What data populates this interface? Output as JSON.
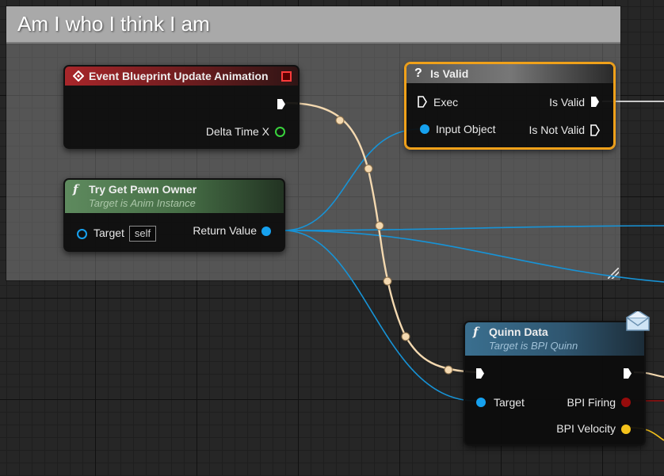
{
  "comment": {
    "title": "Am I who I think I am"
  },
  "nodes": {
    "event_update": {
      "title": "Event Blueprint Update Animation",
      "delta_time_label": "Delta Time X"
    },
    "try_get_pawn_owner": {
      "title": "Try Get Pawn Owner",
      "subtitle": "Target is Anim Instance",
      "target_label": "Target",
      "target_value": "self",
      "return_label": "Return Value"
    },
    "is_valid": {
      "title": "Is Valid",
      "exec_label": "Exec",
      "input_object_label": "Input Object",
      "is_valid_label": "Is Valid",
      "is_not_valid_label": "Is Not Valid"
    },
    "quinn_data": {
      "title": "Quinn Data",
      "subtitle": "Target is BPI Quinn",
      "target_label": "Target",
      "bpi_firing_label": "BPI Firing",
      "bpi_velocity_label": "BPI Velocity"
    }
  },
  "icons": {
    "event": "diamond-event-icon",
    "function": "function-f-icon",
    "is_valid": "question-mark-icon",
    "message": "envelope-icon"
  },
  "colors": {
    "exec_wire": "#f4d9b0",
    "object_wire": "#1793d6",
    "selected_outline": "#f0a11a",
    "event_header": "#a8262a",
    "pure_header": "#5e8a5e",
    "function_header": "#3a6f8f"
  }
}
